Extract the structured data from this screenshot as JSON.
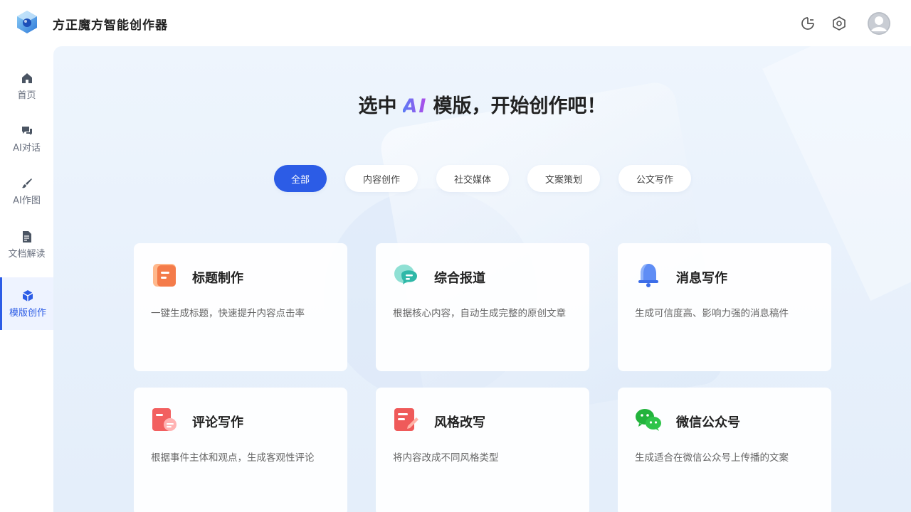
{
  "app": {
    "title": "方正魔方智能创作器"
  },
  "header": {
    "icons": [
      "history-icon",
      "settings-icon",
      "avatar-icon"
    ]
  },
  "sidebar": {
    "items": [
      {
        "label": "首页",
        "icon": "home-icon"
      },
      {
        "label": "AI对话",
        "icon": "chat-icon"
      },
      {
        "label": "AI作图",
        "icon": "brush-icon"
      },
      {
        "label": "文档解读",
        "icon": "document-icon"
      },
      {
        "label": "模版创作",
        "icon": "cube-icon",
        "active": true
      }
    ]
  },
  "main": {
    "headline_prefix": "选中",
    "headline_ai": "AI",
    "headline_suffix": "模版，开始创作吧！",
    "tabs": [
      {
        "label": "全部",
        "active": true
      },
      {
        "label": "内容创作"
      },
      {
        "label": "社交媒体"
      },
      {
        "label": "文案策划"
      },
      {
        "label": "公文写作"
      }
    ],
    "cards": [
      {
        "title": "标题制作",
        "desc": "一键生成标题，快速提升内容点击率",
        "icon": "title-doc-icon"
      },
      {
        "title": "综合报道",
        "desc": "根据核心内容，自动生成完整的原创文章",
        "icon": "chat-bubble-icon"
      },
      {
        "title": "消息写作",
        "desc": "生成可信度高、影响力强的消息稿件",
        "icon": "bell-icon"
      },
      {
        "title": "评论写作",
        "desc": "根据事件主体和观点，生成客观性评论",
        "icon": "comment-doc-icon"
      },
      {
        "title": "风格改写",
        "desc": "将内容改成不同风格类型",
        "icon": "edit-doc-icon"
      },
      {
        "title": "微信公众号",
        "desc": "生成适合在微信公众号上传播的文案",
        "icon": "wechat-icon"
      }
    ]
  },
  "colors": {
    "accent": "#2c5ce6",
    "background": "#eef5fd"
  }
}
